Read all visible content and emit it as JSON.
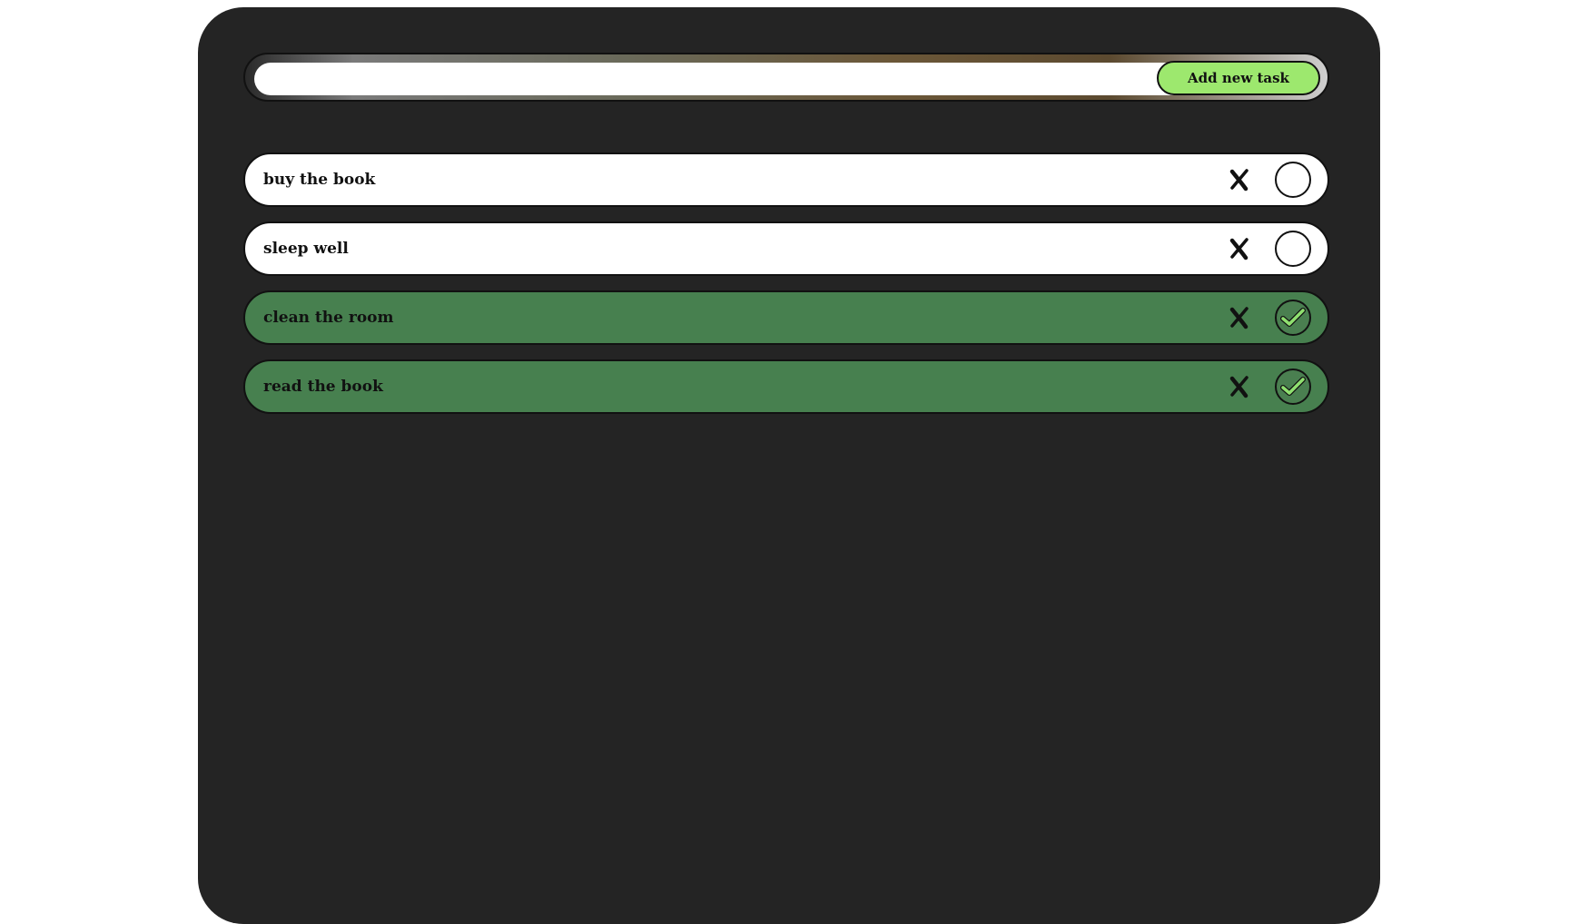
{
  "input": {
    "value": "",
    "placeholder": ""
  },
  "add_button": {
    "label": "Add new task"
  },
  "tasks": [
    {
      "label": "buy the book",
      "done": false
    },
    {
      "label": "sleep well",
      "done": false
    },
    {
      "label": "clean the room",
      "done": true
    },
    {
      "label": "read the book",
      "done": true
    }
  ],
  "icons": {
    "delete": "close-x-icon",
    "check": "checkmark-icon"
  },
  "colors": {
    "panel_bg": "#242424",
    "pending_task_bg": "#ffffff",
    "done_task_bg": "#47804f",
    "add_button_bg": "#9de86e",
    "checkmark": "#8fe070",
    "border": "#111111"
  }
}
